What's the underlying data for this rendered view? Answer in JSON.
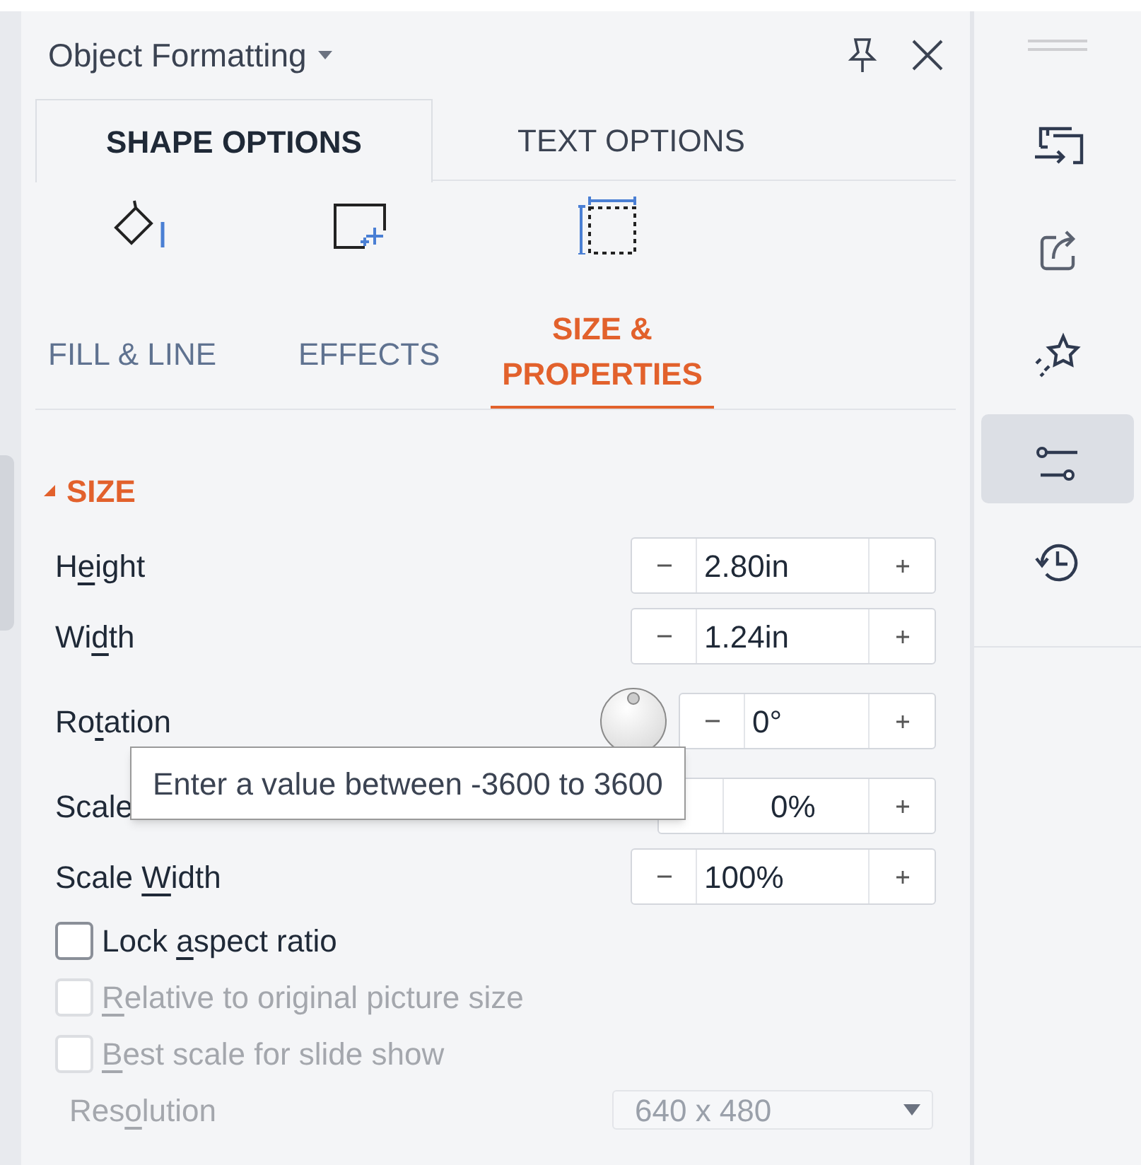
{
  "panel": {
    "title": "Object Formatting"
  },
  "tabs": [
    {
      "label": "SHAPE OPTIONS",
      "selected": true
    },
    {
      "label": "TEXT OPTIONS",
      "selected": false
    }
  ],
  "subtabs": [
    {
      "label": "FILL & LINE",
      "selected": false
    },
    {
      "label": "EFFECTS",
      "selected": false
    },
    {
      "label": "SIZE & PROPERTIES",
      "selected": true
    }
  ],
  "section": {
    "title": "SIZE",
    "expanded": true
  },
  "fields": [
    {
      "kind": "spinner",
      "label": {
        "before": "H",
        "key": "e",
        "after": "ight"
      },
      "value": "2.80in"
    },
    {
      "kind": "spinner",
      "label": {
        "before": "Wi",
        "key": "d",
        "after": "th"
      },
      "value": "1.24in"
    },
    {
      "kind": "rotation",
      "label": {
        "before": "Ro",
        "key": "t",
        "after": "ation"
      },
      "value": "0°"
    },
    {
      "kind": "covered",
      "label": {
        "before": "Scale"
      },
      "value": "0%"
    },
    {
      "kind": "spinner",
      "label": {
        "before": "Scale ",
        "key": "W",
        "after": "idth"
      },
      "value": "100%"
    }
  ],
  "checkboxes": [
    {
      "label": {
        "before": "Lock ",
        "key": "a",
        "after": "spect ratio"
      },
      "checked": false,
      "disabled": false
    },
    {
      "label": {
        "key": "R",
        "after": "elative to original picture size"
      },
      "checked": false,
      "disabled": true
    },
    {
      "label": {
        "key": "B",
        "after": "est scale for slide show"
      },
      "checked": false,
      "disabled": true
    }
  ],
  "resolution": {
    "label": {
      "before": "Res",
      "key": "o",
      "after": "lution"
    },
    "value": "640 x 480",
    "disabled": true
  },
  "tooltip": {
    "text": "Enter a value between -3600 to 3600"
  },
  "sidebar": {
    "items": [
      {
        "selected": false
      },
      {
        "selected": false
      },
      {
        "selected": false
      },
      {
        "selected": true
      },
      {
        "selected": false
      }
    ]
  }
}
